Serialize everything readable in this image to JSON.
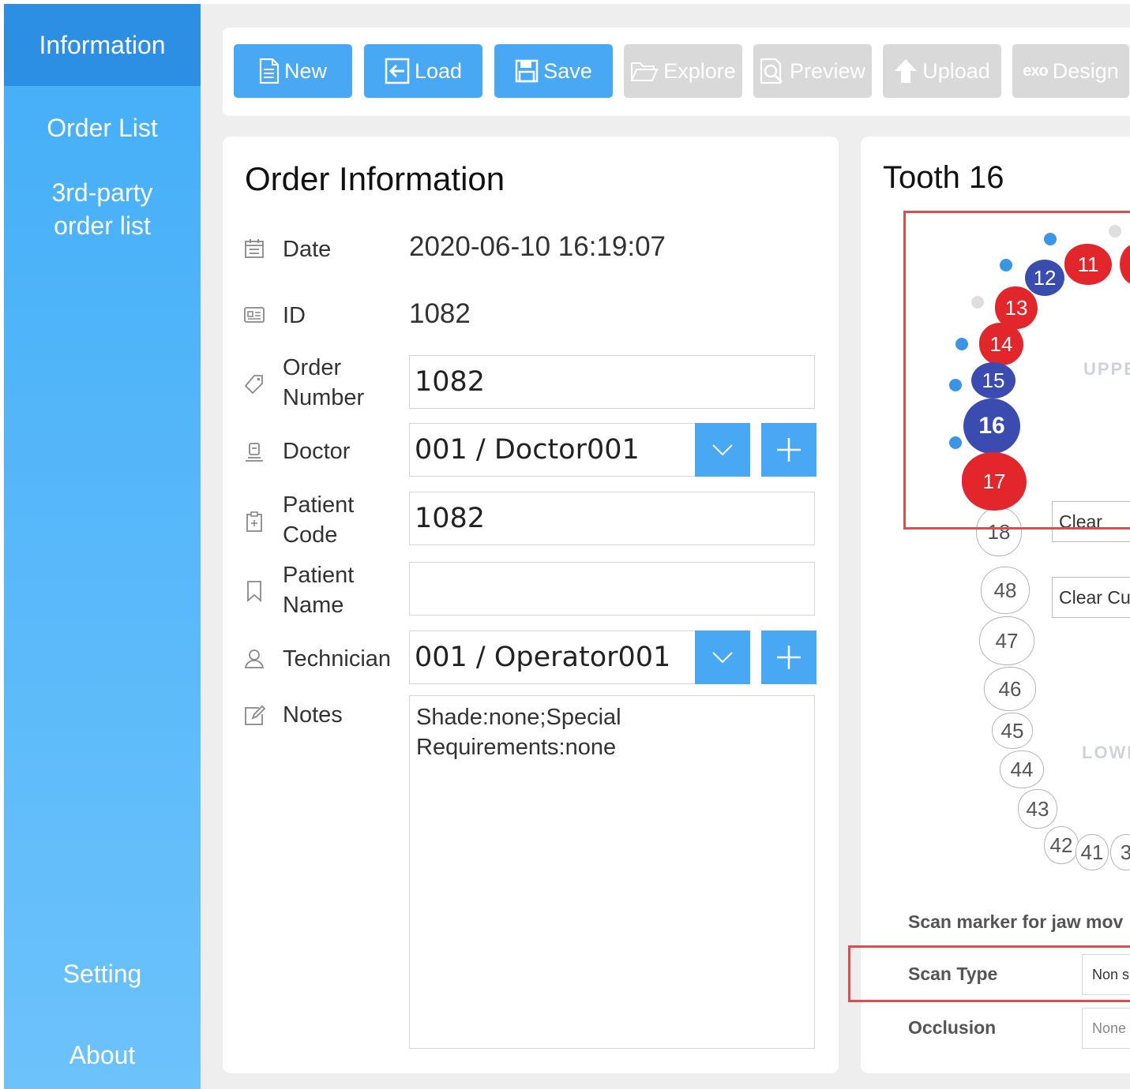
{
  "sidebar": {
    "items": [
      {
        "label": "Information"
      },
      {
        "label": "Order List"
      },
      {
        "label": "3rd-party\norder list"
      },
      {
        "label": "Setting"
      },
      {
        "label": "About"
      }
    ]
  },
  "toolbar": {
    "new": "New",
    "load": "Load",
    "save": "Save",
    "explore": "Explore",
    "preview": "Preview",
    "upload": "Upload",
    "design_prefix": "exo",
    "design": "Design"
  },
  "order": {
    "title": "Order Information",
    "date_label": "Date",
    "date_value": "2020-06-10 16:19:07",
    "id_label": "ID",
    "id_value": "1082",
    "order_number_label": "Order\nNumber",
    "order_number_value": "1082",
    "doctor_label": "Doctor",
    "doctor_value": "001 / Doctor001",
    "patient_code_label": "Patient\nCode",
    "patient_code_value": "1082",
    "patient_name_label": "Patient\nName",
    "patient_name_value": "",
    "technician_label": "Technician",
    "technician_value": "001 / Operator001",
    "notes_label": "Notes",
    "notes_value": "Shade:none;Special\nRequirements:none"
  },
  "tooth": {
    "title": "Tooth 16",
    "upper_label": "UPPE",
    "lower_label": "LOWE",
    "clear_label": "Clear",
    "clear_current_label": "Clear Cu",
    "scan_marker_label": "Scan marker for jaw mov",
    "scan_type_label": "Scan Type",
    "scan_type_value": "Non s",
    "occlusion_label": "Occlusion",
    "occlusion_value": "None",
    "teeth": {
      "t11": "11",
      "t12": "12",
      "t13": "13",
      "t14": "14",
      "t15": "15",
      "t16": "16",
      "t17": "17",
      "t18": "18",
      "t48": "48",
      "t47": "47",
      "t46": "46",
      "t45": "45",
      "t44": "44",
      "t43": "43",
      "t42": "42",
      "t41": "41",
      "t31": "3"
    }
  },
  "colors": {
    "sidebar": "#43aef8",
    "sidebar_active": "#2d8fe3",
    "button_active": "#49a8f3",
    "button_disabled": "#d9d9d9",
    "tooth_red": "#e3262c",
    "tooth_blue": "#3b4cb0",
    "highlight_box": "#d94e4e"
  }
}
